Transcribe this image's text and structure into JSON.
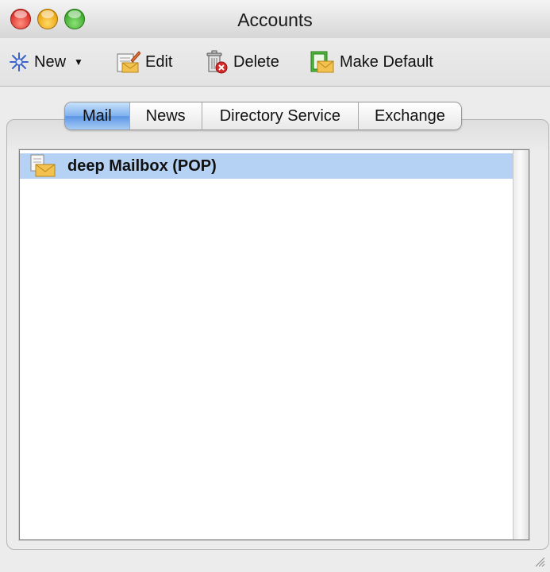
{
  "window": {
    "title": "Accounts"
  },
  "toolbar": {
    "new_label": "New",
    "edit_label": "Edit",
    "delete_label": "Delete",
    "make_default_label": "Make Default"
  },
  "tabs": [
    {
      "label": "Mail",
      "active": true
    },
    {
      "label": "News"
    },
    {
      "label": "Directory Service"
    },
    {
      "label": "Exchange"
    }
  ],
  "accounts": [
    {
      "name": "deep Mailbox (POP)",
      "selected": true,
      "icon": "mailbox-icon"
    }
  ],
  "colors": {
    "selection": "#b5d1f3",
    "active_tab": "#7fb1ee"
  }
}
